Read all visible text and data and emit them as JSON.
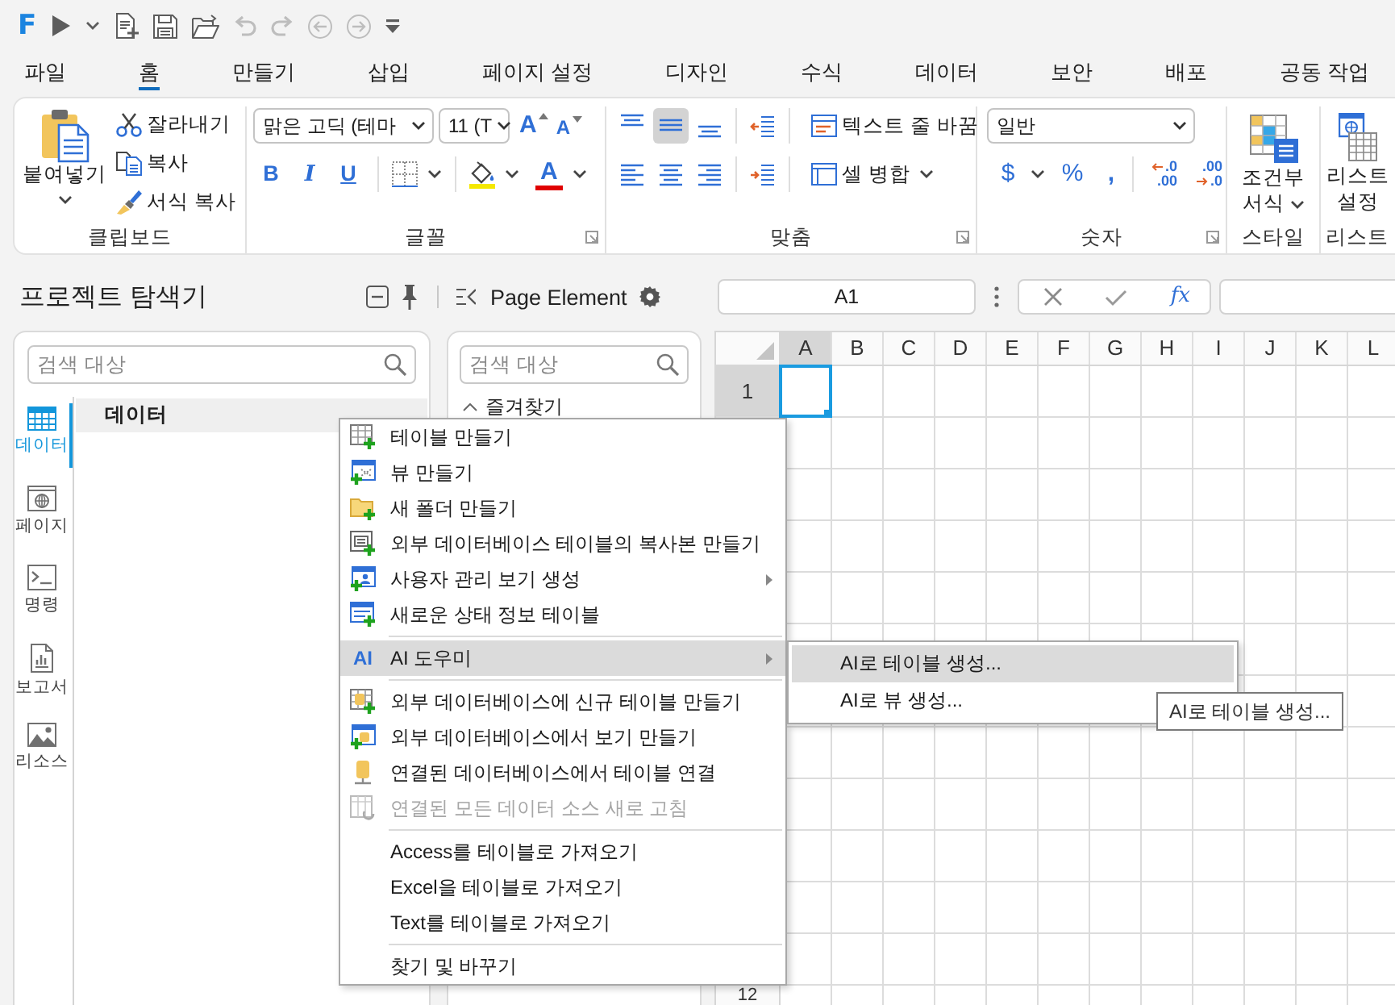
{
  "quick_access": {
    "logo": "F",
    "tools": [
      {
        "kind": "run",
        "disabled": false
      },
      {
        "kind": "dropdown",
        "disabled": false
      },
      {
        "kind": "new",
        "disabled": false
      },
      {
        "kind": "save",
        "disabled": false
      },
      {
        "kind": "open",
        "disabled": false
      },
      {
        "kind": "undo",
        "disabled": true
      },
      {
        "kind": "redo",
        "disabled": true
      },
      {
        "kind": "back",
        "disabled": true
      },
      {
        "kind": "forward",
        "disabled": true
      },
      {
        "kind": "customize",
        "disabled": false
      }
    ]
  },
  "tabs": [
    {
      "label": "파일",
      "selected": false
    },
    {
      "label": "홈",
      "selected": true
    },
    {
      "label": "만들기",
      "selected": false
    },
    {
      "label": "삽입",
      "selected": false
    },
    {
      "label": "페이지 설정",
      "selected": false
    },
    {
      "label": "디자인",
      "selected": false
    },
    {
      "label": "수식",
      "selected": false
    },
    {
      "label": "데이터",
      "selected": false
    },
    {
      "label": "보안",
      "selected": false
    },
    {
      "label": "배포",
      "selected": false
    },
    {
      "label": "공동 작업",
      "selected": false
    }
  ],
  "ribbon": {
    "clipboard": {
      "label": "클립보드",
      "paste": "붙여넣기",
      "buttons": [
        {
          "kind": "cut",
          "label": "잘라내기"
        },
        {
          "kind": "copy",
          "label": "복사"
        },
        {
          "kind": "format_painter",
          "label": "서식 복사"
        }
      ]
    },
    "font": {
      "label": "글꼴",
      "font_name": "맑은 고딕 (테마",
      "font_size": "11 (T",
      "size_buttons": [
        {
          "kind": "grow",
          "glyph": "A"
        },
        {
          "kind": "shrink",
          "glyph": "A"
        }
      ],
      "styles": [
        {
          "kind": "bold",
          "glyph": "B"
        },
        {
          "kind": "italic",
          "glyph": "I"
        },
        {
          "kind": "underline",
          "glyph": "U"
        }
      ],
      "font_color": "A"
    },
    "alignment": {
      "label": "맞춤",
      "vertical": [
        {
          "kind": "top",
          "selected": false
        },
        {
          "kind": "middle",
          "selected": true
        },
        {
          "kind": "bottom",
          "selected": false
        }
      ],
      "horizontal": [
        {
          "kind": "left",
          "selected": false
        },
        {
          "kind": "center",
          "selected": false
        },
        {
          "kind": "right",
          "selected": false
        }
      ],
      "wrap_text": "텍스트 줄 바꿈",
      "merge": "셀 병합"
    },
    "number": {
      "label": "숫자",
      "format": "일반",
      "symbols": [
        {
          "kind": "currency",
          "glyph": "$"
        },
        {
          "kind": "percent",
          "glyph": "%"
        },
        {
          "kind": "comma",
          "glyph": ","
        }
      ],
      "decimals": [
        {
          "kind": "increase",
          "top": ".0",
          "bottom": ".00"
        },
        {
          "kind": "decrease",
          "top": ".00",
          "bottom": ".0"
        }
      ]
    },
    "styles": {
      "label": "스타일",
      "conditional_formatting": "조건부 서식"
    },
    "list": {
      "label": "리스트",
      "settings": "리스트 설정"
    }
  },
  "explorer": {
    "title": "프로젝트 탐색기",
    "search": {
      "placeholder": "검색 대상"
    },
    "nav": [
      {
        "kind": "data",
        "label": "데이터",
        "selected": true
      },
      {
        "kind": "pages",
        "label": "페이지",
        "selected": false
      },
      {
        "kind": "commands",
        "label": "명령",
        "selected": false
      },
      {
        "kind": "reports",
        "label": "보고서",
        "selected": false
      },
      {
        "kind": "resources",
        "label": "리소스",
        "selected": false
      }
    ],
    "tree_header": "데이터"
  },
  "page_element": {
    "title": "Page Element",
    "search": {
      "placeholder": "검색 대상"
    },
    "sections": [
      {
        "label": "즐겨찾기",
        "expanded": true
      }
    ]
  },
  "formula_bar": {
    "name_box": "A1",
    "function": "fx"
  },
  "sheet": {
    "columns": [
      {
        "label": "A",
        "selected": true
      },
      {
        "label": "B",
        "selected": false
      },
      {
        "label": "C",
        "selected": false
      },
      {
        "label": "D",
        "selected": false
      },
      {
        "label": "E",
        "selected": false
      },
      {
        "label": "F",
        "selected": false
      },
      {
        "label": "G",
        "selected": false
      },
      {
        "label": "H",
        "selected": false
      },
      {
        "label": "I",
        "selected": false
      },
      {
        "label": "J",
        "selected": false
      },
      {
        "label": "K",
        "selected": false
      },
      {
        "label": "L",
        "selected": false
      }
    ],
    "rows": [
      {
        "label": "1",
        "selected": true
      },
      {
        "label": "12",
        "selected": false
      }
    ]
  },
  "context_menu": {
    "sections": [
      {
        "items": [
          {
            "kind": "new_table",
            "label": "테이블 만들기",
            "submenu": false,
            "disabled": false,
            "selected": false
          },
          {
            "kind": "new_view",
            "label": "뷰 만들기",
            "submenu": false,
            "disabled": false,
            "selected": false
          },
          {
            "kind": "new_folder",
            "label": "새 폴더 만들기",
            "submenu": false,
            "disabled": false,
            "selected": false
          },
          {
            "kind": "copy_external",
            "label": "외부 데이터베이스 테이블의 복사본 만들기",
            "submenu": false,
            "disabled": false,
            "selected": false
          },
          {
            "kind": "user_view",
            "label": "사용자 관리 보기 생성",
            "submenu": true,
            "disabled": false,
            "selected": false
          },
          {
            "kind": "status_table",
            "label": "새로운 상태 정보 테이블",
            "submenu": false,
            "disabled": false,
            "selected": false
          }
        ]
      },
      {
        "items": [
          {
            "kind": "ai",
            "icon_text": "AI",
            "label": "AI 도우미",
            "submenu": true,
            "disabled": false,
            "selected": true
          }
        ]
      },
      {
        "items": [
          {
            "kind": "external_table",
            "label": "외부 데이터베이스에 신규 테이블 만들기",
            "submenu": false,
            "disabled": false,
            "selected": false
          },
          {
            "kind": "external_view",
            "label": "외부 데이터베이스에서 보기 만들기",
            "submenu": false,
            "disabled": false,
            "selected": false
          },
          {
            "kind": "link_table",
            "label": "연결된 데이터베이스에서 테이블 연결",
            "submenu": false,
            "disabled": false,
            "selected": false
          },
          {
            "kind": "refresh",
            "label": "연결된 모든 데이터 소스 새로 고침",
            "submenu": false,
            "disabled": true,
            "selected": false
          }
        ]
      },
      {
        "items": [
          {
            "kind": "plain",
            "label": "Access를 테이블로 가져오기",
            "submenu": false,
            "disabled": false,
            "selected": false
          },
          {
            "kind": "plain",
            "label": "Excel을 테이블로 가져오기",
            "submenu": false,
            "disabled": false,
            "selected": false
          },
          {
            "kind": "plain",
            "label": "Text를 테이블로 가져오기",
            "submenu": false,
            "disabled": false,
            "selected": false
          }
        ]
      },
      {
        "items": [
          {
            "kind": "plain",
            "label": "찾기 및 바꾸기",
            "submenu": false,
            "disabled": false,
            "selected": false
          }
        ]
      }
    ]
  },
  "submenu": {
    "items": [
      {
        "label": "AI로 테이블 생성...",
        "selected": true
      },
      {
        "label": "AI로 뷰 생성...",
        "selected": false
      }
    ]
  },
  "tooltip": {
    "text": "AI로 테이블 생성..."
  }
}
